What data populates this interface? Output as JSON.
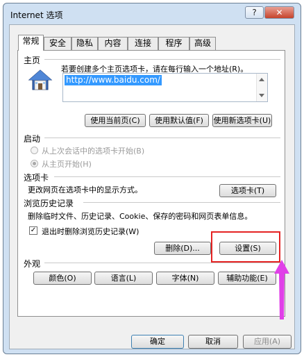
{
  "window": {
    "title": "Internet 选项",
    "help_label": "?",
    "close_label": "✕"
  },
  "tabs": [
    {
      "label": "常规",
      "active": true
    },
    {
      "label": "安全"
    },
    {
      "label": "隐私"
    },
    {
      "label": "内容"
    },
    {
      "label": "连接"
    },
    {
      "label": "程序"
    },
    {
      "label": "高级"
    }
  ],
  "homepage": {
    "section_label": "主页",
    "description": "若要创建多个主页选项卡，请在每行输入一个地址(R)。",
    "url": "http://www.baidu.com/",
    "icon": "house-icon",
    "buttons": {
      "use_current": "使用当前页(C)",
      "use_default": "使用默认值(F)",
      "use_new_tab": "使用新选项卡(U)"
    }
  },
  "startup": {
    "section_label": "启动",
    "option_last_session": "从上次会话中的选项卡开始(B)",
    "option_homepage": "从主页开始(H)",
    "selected": "homepage"
  },
  "tabs_section": {
    "section_label": "选项卡",
    "description": "更改网页在选项卡中的显示方式。",
    "button": "选项卡(T)"
  },
  "history": {
    "section_label": "浏览历史记录",
    "description": "删除临时文件、历史记录、Cookie、保存的密码和网页表单信息。",
    "checkbox_label": "退出时删除浏览历史记录(W)",
    "checkbox_checked": true,
    "delete_button": "删除(D)...",
    "settings_button": "设置(S)"
  },
  "appearance": {
    "section_label": "外观",
    "colors_button": "颜色(O)",
    "languages_button": "语言(L)",
    "fonts_button": "字体(N)",
    "accessibility_button": "辅助功能(E)"
  },
  "footer": {
    "ok_button": "确定",
    "cancel_button": "取消",
    "apply_button": "应用(A)"
  },
  "annotation": {
    "highlight_color": "#e52222",
    "arrow_color": "#e040e8"
  }
}
